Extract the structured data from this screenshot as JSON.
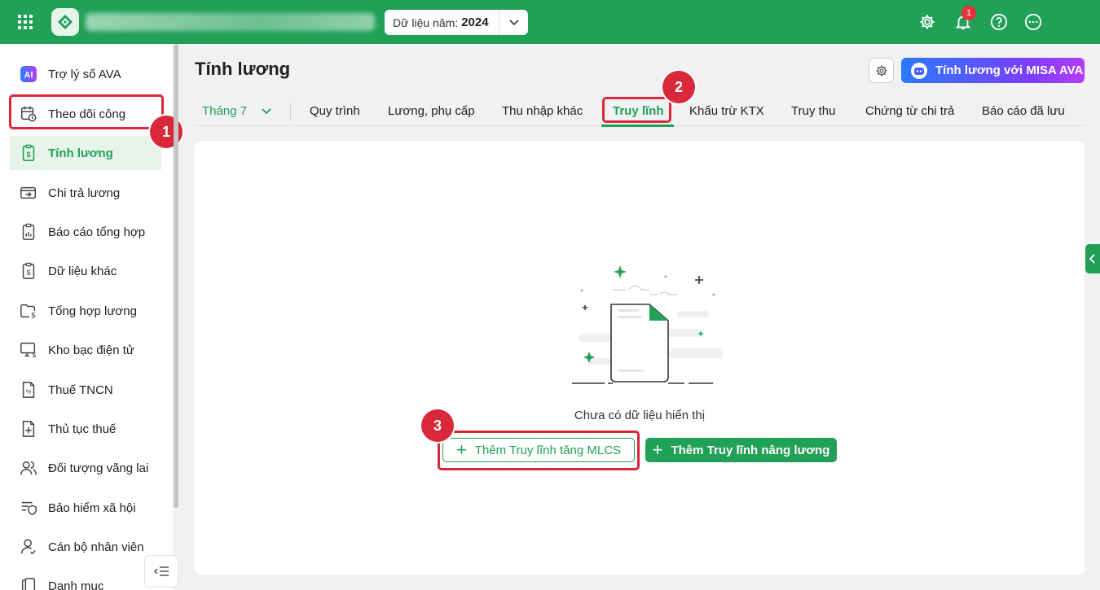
{
  "colors": {
    "brand": "#21a058",
    "highlight": "#d9283a",
    "badge": "#e8313b",
    "ava_gradient_start": "#2a7bff",
    "ava_gradient_end": "#b43dff"
  },
  "topbar": {
    "year_label": "Dữ liệu năm:",
    "year_value": "2024",
    "notification_count": "1",
    "icons": [
      "apps-grid-icon",
      "app-logo",
      "chevron-down-icon",
      "settings-icon",
      "bell-icon",
      "help-icon",
      "more-icon"
    ]
  },
  "sidebar": {
    "items": [
      {
        "label": "Trợ lý số AVA",
        "icon": "ai-icon"
      },
      {
        "label": "Theo dõi công",
        "icon": "calendar-clock-icon"
      },
      {
        "label": "Tính lương",
        "icon": "salary-icon",
        "active": true
      },
      {
        "label": "Chi trả lương",
        "icon": "wallet-icon"
      },
      {
        "label": "Báo cáo tổng hợp",
        "icon": "report-icon"
      },
      {
        "label": "Dữ liệu khác",
        "icon": "data-icon"
      },
      {
        "label": "Tổng hợp lương",
        "icon": "folder-money-icon"
      },
      {
        "label": "Kho bạc điện tử",
        "icon": "treasury-icon"
      },
      {
        "label": "Thuế TNCN",
        "icon": "tax-icon"
      },
      {
        "label": "Thủ tục thuế",
        "icon": "tax-procedure-icon"
      },
      {
        "label": "Đối tượng vãng lai",
        "icon": "users-icon"
      },
      {
        "label": "Bảo hiểm xã hội",
        "icon": "insurance-icon"
      },
      {
        "label": "Cán bộ nhân viên",
        "icon": "employee-icon"
      },
      {
        "label": "Danh mục",
        "icon": "catalog-icon"
      }
    ]
  },
  "main": {
    "title": "Tính lương",
    "ava_button": "Tính lương với MISA AVA",
    "month_tab": "Tháng 7",
    "tabs": [
      "Quy trình",
      "Lương, phụ cấp",
      "Thu nhập khác",
      "Truy lĩnh",
      "Khấu trừ KTX",
      "Truy thu",
      "Chứng từ chi trả",
      "Báo cáo đã lưu"
    ],
    "active_tab": "Truy lĩnh",
    "empty_text": "Chưa có dữ liệu hiển thị",
    "btn_add_mlcs": "Thêm Truy lĩnh tăng MLCS",
    "btn_add_raise": "Thêm Truy lĩnh nâng lương"
  },
  "annotations": {
    "step1": "1",
    "step2": "2",
    "step3": "3"
  }
}
